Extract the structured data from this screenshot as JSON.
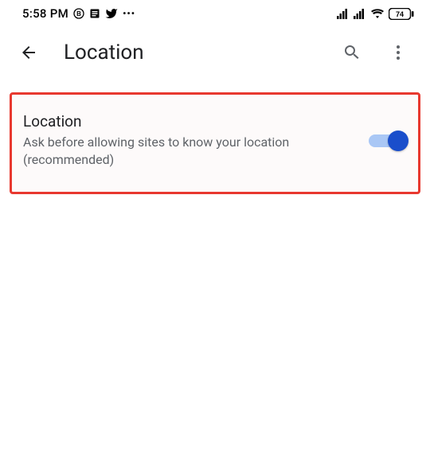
{
  "status": {
    "time": "5:58 PM",
    "battery": "74"
  },
  "header": {
    "title": "Location"
  },
  "setting": {
    "title": "Location",
    "description": "Ask before allowing sites to know your location (recommended)",
    "enabled": true
  }
}
